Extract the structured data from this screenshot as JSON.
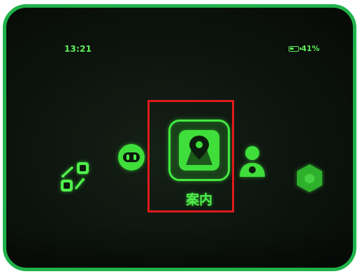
{
  "status_bar": {
    "time": "13:21",
    "battery_percent": "41%",
    "battery_level": 0.41
  },
  "menu": {
    "items": [
      {
        "icon": "translate-icon",
        "selected": false
      },
      {
        "icon": "robot-face-icon",
        "selected": false
      },
      {
        "icon": "location-pin-icon",
        "label": "案内",
        "selected": true
      },
      {
        "icon": "person-icon",
        "selected": false
      },
      {
        "icon": "hexagon-icon",
        "selected": false
      }
    ]
  },
  "colors": {
    "glow_green": "#4ff04a",
    "frame_green": "#1fb24a",
    "highlight_red": "#e01a1a",
    "background": "#0c130d"
  }
}
